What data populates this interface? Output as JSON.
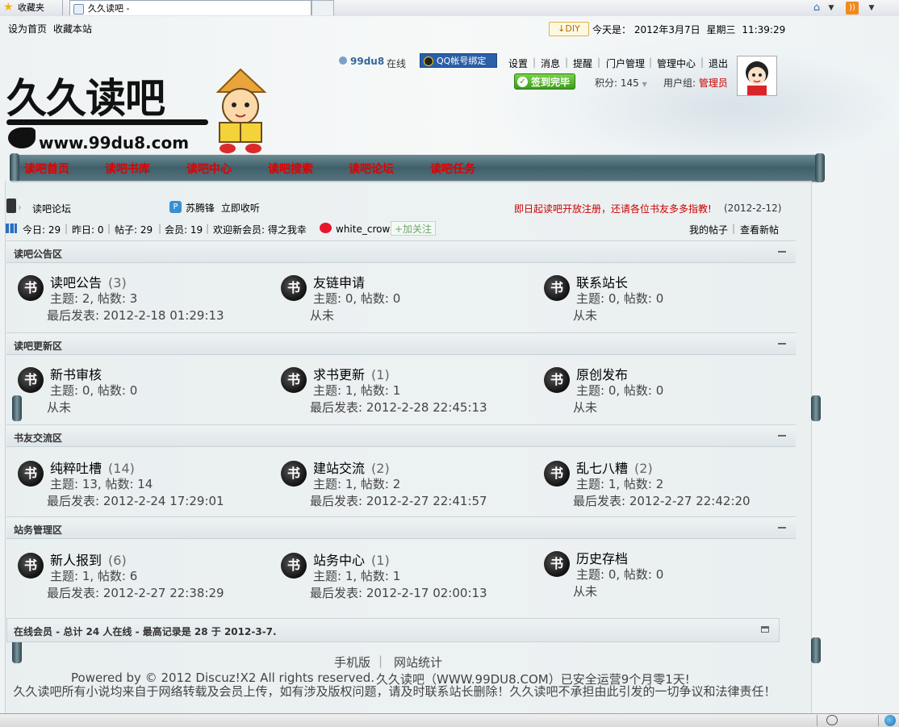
{
  "browser": {
    "favorites_tab": "收藏夹",
    "page_tab": "久久读吧 -",
    "tools": [
      "home-icon",
      "dropdown-icon",
      "feed-icon",
      "dropdown-icon"
    ]
  },
  "toplinks": {
    "set_home": "设为首页",
    "bookmark": "收藏本站",
    "diy": "DIY",
    "date_label": "今天是：",
    "date_value": "2012年3月7日",
    "weekday": "星期三",
    "time": "11:39:29"
  },
  "logo": {
    "text": "久久读吧",
    "url": "www.99du8.com"
  },
  "user": {
    "name": "99du8",
    "status": "在线",
    "qq_bind": "QQ帐号绑定",
    "links": [
      "设置",
      "消息",
      "提醒",
      "门户管理",
      "管理中心",
      "退出"
    ],
    "signin": "签到完毕",
    "points_label": "积分:",
    "points_value": "145",
    "group_label": "用户组:",
    "group_value": "管理员"
  },
  "nav": [
    "读吧首页",
    "读吧书库",
    "读吧中心",
    "读吧搜索",
    "读吧论坛",
    "读吧任务"
  ],
  "breadcrumb": {
    "text": "读吧论坛",
    "weibo_user": "苏腾锋",
    "weibo_action": "立即收听"
  },
  "notice": {
    "text": "即日起读吧开放注册，还请各位书友多多指教!",
    "date": "(2012-2-12)"
  },
  "stats": {
    "today": "今日: 29",
    "yesterday": "昨日: 0",
    "posts": "帖子: 29",
    "members": "会员: 19",
    "welcome": "欢迎新会员: 得之我幸",
    "weibo_name": "white_crow",
    "follow": "+加关注",
    "my_posts": "我的帖子",
    "new_posts": "查看新帖"
  },
  "sections": [
    {
      "title": "读吧公告区",
      "forums": [
        {
          "name": "读吧公告",
          "count": "(3)",
          "stats": "主题: 2, 帖数: 3",
          "last": "最后发表: 2012-2-18 01:29:13"
        },
        {
          "name": "友链申请",
          "count": "",
          "stats": "主题: 0, 帖数: 0",
          "last": "从未"
        },
        {
          "name": "联系站长",
          "count": "",
          "stats": "主题: 0, 帖数: 0",
          "last": "从未"
        }
      ]
    },
    {
      "title": "读吧更新区",
      "forums": [
        {
          "name": "新书审核",
          "count": "",
          "stats": "主题: 0, 帖数: 0",
          "last": "从未"
        },
        {
          "name": "求书更新",
          "count": "(1)",
          "stats": "主题: 1, 帖数: 1",
          "last": "最后发表: 2012-2-28 22:45:13"
        },
        {
          "name": "原创发布",
          "count": "",
          "stats": "主题: 0, 帖数: 0",
          "last": "从未"
        }
      ]
    },
    {
      "title": "书友交流区",
      "forums": [
        {
          "name": "纯粹吐槽",
          "count": "(14)",
          "stats": "主题: 13, 帖数: 14",
          "last": "最后发表: 2012-2-24 17:29:01"
        },
        {
          "name": "建站交流",
          "count": "(2)",
          "stats": "主题: 1, 帖数: 2",
          "last": "最后发表: 2012-2-27 22:41:57"
        },
        {
          "name": "乱七八糟",
          "count": "(2)",
          "stats": "主题: 1, 帖数: 2",
          "last": "最后发表: 2012-2-27 22:42:20"
        }
      ]
    },
    {
      "title": "站务管理区",
      "forums": [
        {
          "name": "新人报到",
          "count": "(6)",
          "stats": "主题: 1, 帖数: 6",
          "last": "最后发表: 2012-2-27 22:38:29"
        },
        {
          "name": "站务中心",
          "count": "(1)",
          "stats": "主题: 1, 帖数: 1",
          "last": "最后发表: 2012-2-17 02:00:13"
        },
        {
          "name": "历史存档",
          "count": "",
          "stats": "主题: 0, 帖数: 0",
          "last": "从未"
        }
      ]
    }
  ],
  "online": {
    "text": "在线会员 - 总计 24 人在线 - 最高记录是 28 于 2012-3-7."
  },
  "footer": {
    "mobile": "手机版",
    "stats": "网站统计",
    "powered": "Powered by © 2012 Discuz!X2 All rights reserved.",
    "running": "久久读吧（WWW.99DU8.COM）已安全运营9个月零1天!",
    "disclaimer": "久久读吧所有小说均来自于网络转载及会员上传，如有涉及版权问题，请及时联系站长删除！久久读吧不承担由此引发的一切争议和法律责任！"
  }
}
